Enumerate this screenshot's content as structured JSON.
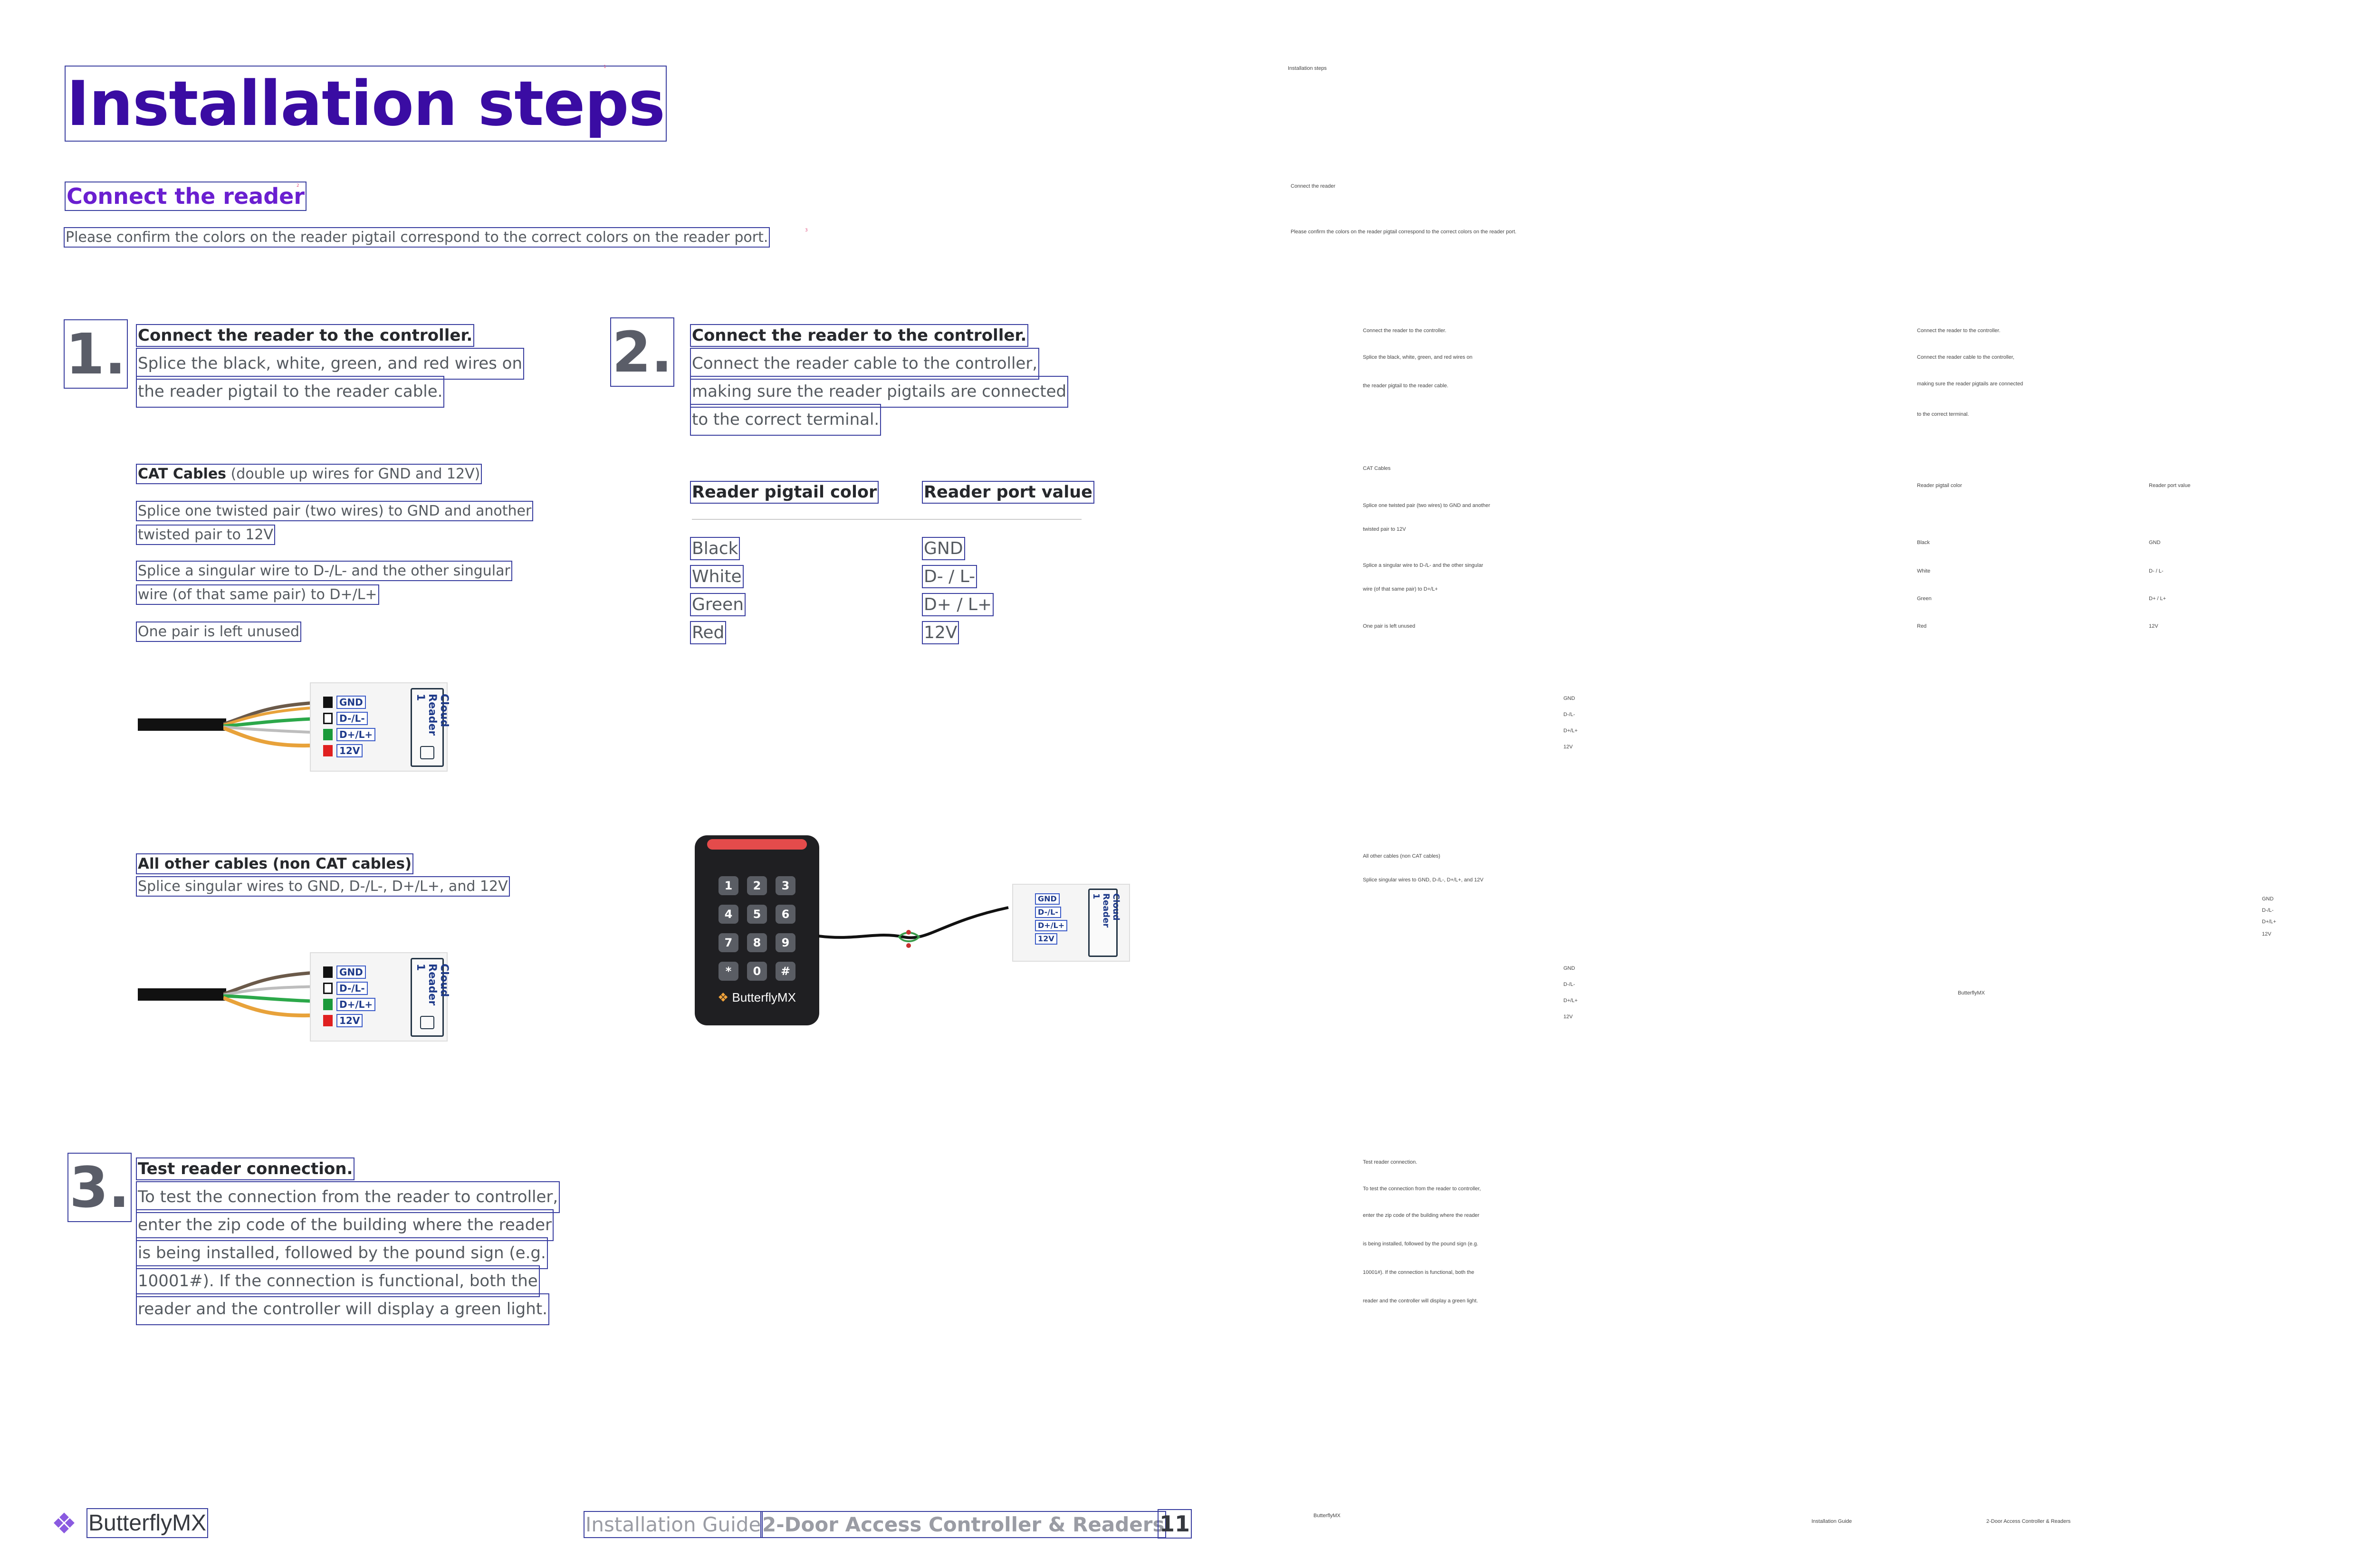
{
  "page": {
    "title": "Installation steps",
    "section_title": "Connect the reader",
    "intro": "Please confirm the colors on the reader pigtail correspond to the correct colors on the reader port."
  },
  "step1": {
    "number": "1.",
    "heading": "Connect the reader to the controller.",
    "body_lines": [
      "Splice the black, white, green, and red wires on",
      "the reader pigtail to the reader cable."
    ],
    "cat_heading": "CAT Cables",
    "cat_note": "(double up wires for GND and 12V)",
    "cat_items": [
      [
        "Splice one twisted pair (two wires) to GND and another",
        "twisted pair to 12V"
      ],
      [
        "Splice a singular wire to D-/L- and the other singular",
        "wire (of that same pair) to D+/L+"
      ],
      [
        "One pair is left unused"
      ]
    ],
    "other_heading": "All other cables (non CAT cables)",
    "other_body": "Splice singular wires to GND, D-/L-, D+/L+, and 12V"
  },
  "step2": {
    "number": "2.",
    "heading": "Connect the reader to the controller.",
    "body_lines": [
      "Connect the reader cable to the controller,",
      "making sure the reader pigtails are connected",
      "to the correct terminal."
    ],
    "table": {
      "headers": [
        "Reader pigtail color",
        "Reader port value"
      ],
      "rows": [
        [
          "Black",
          "GND"
        ],
        [
          "White",
          "D- / L-"
        ],
        [
          "Green",
          "D+ / L+"
        ],
        [
          "Red",
          "12V"
        ]
      ]
    }
  },
  "step3": {
    "number": "3.",
    "heading": "Test reader connection.",
    "body_lines": [
      "To test the connection from the reader to controller,",
      "enter the zip code of the building where the reader",
      "is being installed, followed by the pound sign (e.g.",
      "10001#). If the connection is functional, both the",
      "reader and the controller will display a green light."
    ]
  },
  "diagram": {
    "terminals": [
      "GND",
      "D-/L-",
      "D+/L+",
      "12V"
    ],
    "plate_label": "Cloud Reader 1",
    "terminal_colors": [
      "#111111",
      "#ffffff",
      "#1a9a3a",
      "#e02020"
    ],
    "keypad_keys": [
      "1",
      "2",
      "3",
      "4",
      "5",
      "6",
      "7",
      "8",
      "9",
      "*",
      "0",
      "#"
    ],
    "reader_brand": "ButterflyMX"
  },
  "footer": {
    "logo": "ButterflyMX",
    "guide": "Installation Guide",
    "product": "2-Door Access Controller & Readers",
    "page_number": "11"
  },
  "colors": {
    "title": "#3a0ca3",
    "section": "#6a1fd0",
    "body": "#555a60",
    "annotation_box": "#3a3fa0"
  }
}
